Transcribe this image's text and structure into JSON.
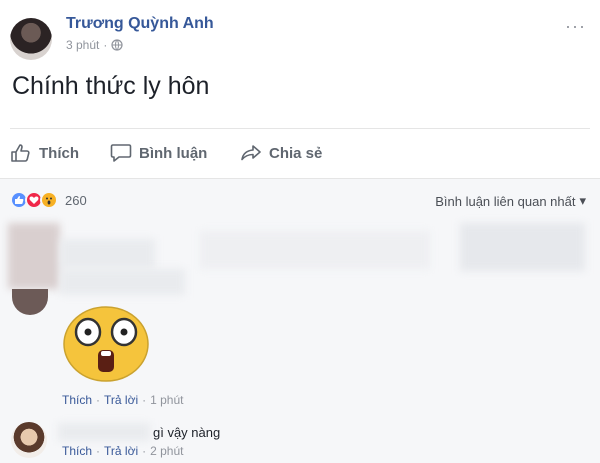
{
  "post": {
    "author": "Trương Quỳnh Anh",
    "time": "3 phút",
    "dot": "·",
    "text": "Chính thức ly hôn",
    "more_glyph": "···"
  },
  "actions": {
    "like_label": "Thích",
    "comment_label": "Bình luận",
    "share_label": "Chia sẻ"
  },
  "reactions": {
    "count": "260",
    "icons": [
      "like-icon",
      "love-icon",
      "wow-icon"
    ]
  },
  "sort": {
    "label": "Bình luận liên quan nhất",
    "arrow": "▾"
  },
  "comments": [
    {
      "sticker": "shocked-face-sticker",
      "like": "Thích",
      "reply": "Trả lời",
      "sep": "·",
      "time": "1 phút"
    },
    {
      "text": "gì vậy nàng",
      "like": "Thích",
      "reply": "Trả lời",
      "sep": "·",
      "time": "2 phút"
    }
  ],
  "colors": {
    "link": "#365899",
    "meta": "#90949c",
    "action": "#606770",
    "panel": "#f6f7f9",
    "like": "#5890ff",
    "love": "#f0284a",
    "wow": "#f7b125"
  }
}
